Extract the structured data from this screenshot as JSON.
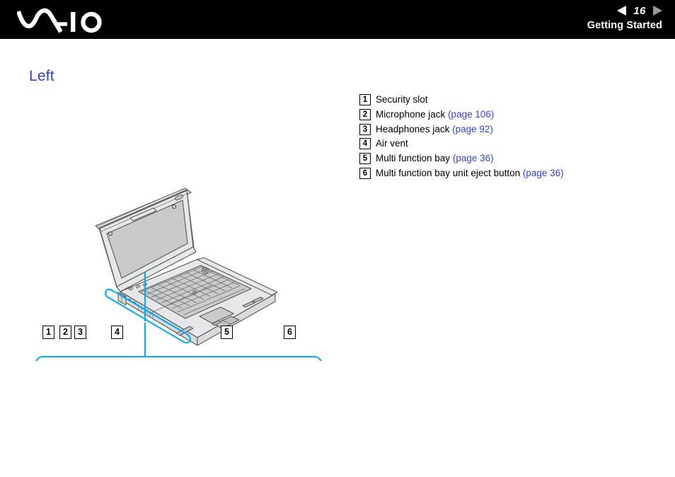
{
  "header": {
    "logo_text": "VAIO",
    "logo_icon": "vaio-logo-icon",
    "page_number": "16",
    "section_title": "Getting Started",
    "prev_icon": "triangle-left-icon",
    "next_icon": "triangle-right-icon"
  },
  "page": {
    "title": "Left"
  },
  "legend": {
    "items": [
      {
        "num": "1",
        "label": "Security slot",
        "ref": ""
      },
      {
        "num": "2",
        "label": "Microphone jack",
        "ref": "(page 106)"
      },
      {
        "num": "3",
        "label": "Headphones jack",
        "ref": "(page 92)"
      },
      {
        "num": "4",
        "label": "Air vent",
        "ref": ""
      },
      {
        "num": "5",
        "label": "Multi function bay",
        "ref": "(page 36)"
      },
      {
        "num": "6",
        "label": "Multi function bay unit eject button",
        "ref": "(page 36)"
      }
    ]
  },
  "illustration": {
    "laptop_alt": "Open notebook computer viewed from front-left",
    "detail_alt": "Close-up of the left side panel of the computer",
    "callouts": [
      {
        "num": "1",
        "target": "security-slot"
      },
      {
        "num": "2",
        "target": "microphone-jack"
      },
      {
        "num": "3",
        "target": "headphones-jack"
      },
      {
        "num": "4",
        "target": "air-vent"
      },
      {
        "num": "5",
        "target": "multi-function-bay"
      },
      {
        "num": "6",
        "target": "multi-function-bay-unit-eject-button"
      }
    ]
  },
  "colors": {
    "header_background": "#000000",
    "heading_blue": "#2e3fbf",
    "link_blue": "#3344cc",
    "callout_cyan": "#00aeef",
    "line_art_stroke": "#58585a",
    "line_art_fill": "#d6d7d8"
  }
}
